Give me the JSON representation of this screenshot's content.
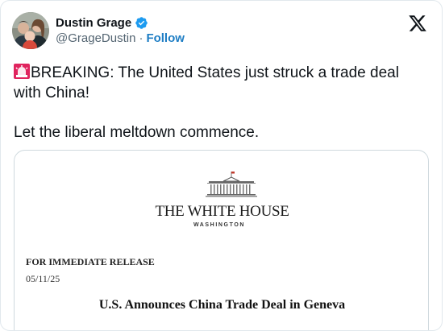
{
  "tweet": {
    "author": {
      "display_name": "Dustin Grage",
      "handle": "@GrageDustin",
      "separator": "·",
      "follow_label": "Follow",
      "verified": true
    },
    "body": {
      "line1": "BREAKING: The United States just struck a trade deal with China!",
      "line2": "Let the liberal meltdown commence."
    },
    "media": {
      "org_title": "THE WHITE HOUSE",
      "org_subtitle": "WASHINGTON",
      "release_label": "FOR IMMEDIATE RELEASE",
      "date": "05/11/25",
      "headline": "U.S. Announces China Trade Deal in Geneva"
    }
  },
  "icons": {
    "platform": "x-logo-icon",
    "verified": "verified-badge-icon",
    "emoji": "rotating-light-emoji"
  },
  "colors": {
    "follow_link": "#1d7dc4",
    "verified_badge": "#1d9bf0",
    "text_primary": "#0f1419",
    "text_secondary": "#536471"
  }
}
